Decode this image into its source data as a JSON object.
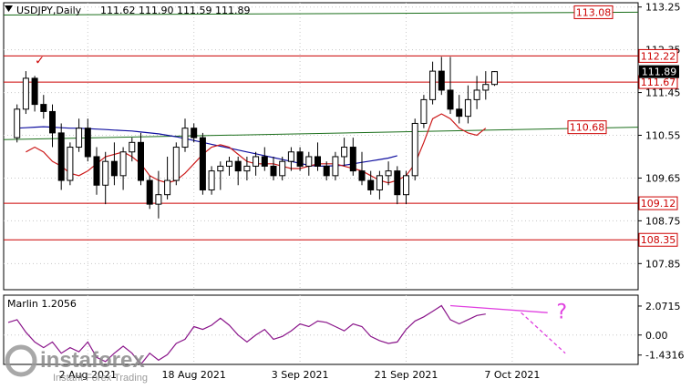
{
  "chart_data": {
    "type": "candlestick",
    "header": {
      "symbol": "USDJPY,Daily",
      "ohlc": "111.62 111.90 111.59 111.89"
    },
    "price_axis": {
      "ylim": [
        107.3,
        113.34
      ],
      "ticks": [
        "113.25",
        "112.35",
        "111.45",
        "110.55",
        "109.65",
        "108.75",
        "107.85"
      ]
    },
    "time_axis": {
      "labels": [
        {
          "text": "2 Aug 2021",
          "idx": 9
        },
        {
          "text": "18 Aug 2021",
          "idx": 21
        },
        {
          "text": "3 Sep 2021",
          "idx": 33
        },
        {
          "text": "21 Sep 2021",
          "idx": 45
        },
        {
          "text": "7 Oct 2021",
          "idx": 57
        }
      ]
    },
    "levels": [
      {
        "label": "113.08",
        "value": 113.08,
        "line_color": "#1a6e1a",
        "label_color": "#cc0000",
        "slope_to": 113.14
      },
      {
        "label": "112.22",
        "value": 112.22,
        "line_color": "#cc0000",
        "label_color": "#cc0000"
      },
      {
        "label": "111.67",
        "value": 111.67,
        "line_color": "#cc0000",
        "label_color": "#cc0000"
      },
      {
        "label": "110.68",
        "value": 110.46,
        "line_color": "#1a6e1a",
        "label_color": "#cc0000",
        "slope_to": 110.72
      },
      {
        "label": "109.12",
        "value": 109.12,
        "line_color": "#cc0000",
        "label_color": "#cc0000"
      },
      {
        "label": "108.35",
        "value": 108.35,
        "line_color": "#cc0000",
        "label_color": "#cc0000"
      }
    ],
    "current_price": "111.89",
    "candles": [
      [
        110.5,
        111.2,
        110.4,
        111.1
      ],
      [
        111.1,
        111.9,
        111.0,
        111.75
      ],
      [
        111.75,
        111.8,
        111.05,
        111.2
      ],
      [
        111.2,
        111.4,
        110.9,
        111.05
      ],
      [
        111.05,
        111.2,
        110.3,
        110.6
      ],
      [
        110.6,
        110.8,
        109.4,
        109.6
      ],
      [
        109.6,
        110.4,
        109.5,
        110.3
      ],
      [
        110.3,
        110.9,
        110.2,
        110.7
      ],
      [
        110.7,
        110.9,
        110.0,
        110.1
      ],
      [
        110.1,
        110.3,
        109.3,
        109.5
      ],
      [
        109.5,
        110.2,
        109.1,
        110.0
      ],
      [
        110.0,
        110.4,
        109.5,
        109.7
      ],
      [
        109.7,
        110.3,
        109.4,
        110.2
      ],
      [
        110.2,
        110.5,
        110.0,
        110.4
      ],
      [
        110.4,
        110.6,
        109.5,
        109.6
      ],
      [
        109.6,
        109.7,
        109.0,
        109.1
      ],
      [
        109.1,
        109.8,
        108.8,
        109.3
      ],
      [
        109.3,
        110.1,
        109.2,
        109.6
      ],
      [
        109.6,
        110.4,
        109.5,
        110.3
      ],
      [
        110.3,
        110.9,
        110.2,
        110.7
      ],
      [
        110.7,
        110.8,
        110.4,
        110.5
      ],
      [
        110.5,
        110.6,
        109.3,
        109.4
      ],
      [
        109.4,
        109.9,
        109.3,
        109.8
      ],
      [
        109.8,
        110.0,
        109.4,
        109.9
      ],
      [
        109.9,
        110.1,
        109.7,
        110.0
      ],
      [
        110.0,
        110.1,
        109.5,
        109.8
      ],
      [
        109.8,
        110.1,
        109.6,
        109.9
      ],
      [
        109.9,
        110.2,
        109.7,
        110.1
      ],
      [
        110.1,
        110.3,
        109.8,
        109.9
      ],
      [
        109.9,
        110.1,
        109.6,
        109.7
      ],
      [
        109.7,
        110.1,
        109.6,
        110.0
      ],
      [
        110.0,
        110.3,
        109.8,
        110.2
      ],
      [
        110.2,
        110.3,
        109.8,
        109.9
      ],
      [
        109.9,
        110.2,
        109.7,
        110.1
      ],
      [
        110.1,
        110.4,
        109.8,
        109.9
      ],
      [
        109.9,
        110.0,
        109.6,
        109.7
      ],
      [
        109.7,
        110.2,
        109.6,
        110.1
      ],
      [
        110.1,
        110.5,
        109.9,
        110.3
      ],
      [
        110.3,
        110.5,
        109.7,
        109.8
      ],
      [
        109.8,
        110.2,
        109.5,
        109.6
      ],
      [
        109.6,
        109.8,
        109.3,
        109.4
      ],
      [
        109.4,
        109.8,
        109.2,
        109.7
      ],
      [
        109.7,
        110.0,
        109.5,
        109.8
      ],
      [
        109.8,
        109.9,
        109.1,
        109.3
      ],
      [
        109.3,
        109.8,
        109.1,
        109.7
      ],
      [
        109.7,
        110.9,
        109.6,
        110.8
      ],
      [
        110.8,
        111.4,
        110.7,
        111.3
      ],
      [
        111.3,
        112.1,
        111.2,
        111.9
      ],
      [
        111.9,
        112.2,
        111.4,
        111.5
      ],
      [
        111.5,
        112.2,
        111.0,
        111.1
      ],
      [
        111.1,
        111.4,
        110.8,
        110.95
      ],
      [
        110.95,
        111.6,
        110.8,
        111.3
      ],
      [
        111.3,
        111.8,
        111.1,
        111.5
      ],
      [
        111.5,
        111.9,
        111.3,
        111.62
      ],
      [
        111.62,
        111.9,
        111.59,
        111.89
      ]
    ],
    "candle_offset": 1,
    "ma_blue": [
      110.7,
      110.71,
      110.72,
      110.73,
      110.72,
      110.71,
      110.7,
      110.7,
      110.69,
      110.68,
      110.67,
      110.66,
      110.65,
      110.64,
      110.62,
      110.6,
      110.58,
      110.55,
      110.52,
      110.48,
      110.44,
      110.4,
      110.36,
      110.32,
      110.28,
      110.24,
      110.2,
      110.16,
      110.12,
      110.08,
      110.04,
      110.0,
      109.96,
      109.92,
      109.9,
      109.9,
      109.91,
      109.92,
      109.95,
      109.98,
      110.01,
      110.04,
      110.07,
      110.12
    ],
    "ma_blue_offset": 1,
    "ma_red": [
      110.2,
      110.3,
      110.2,
      110.0,
      109.9,
      109.75,
      109.7,
      109.8,
      109.95,
      110.1,
      110.15,
      110.2,
      110.1,
      109.95,
      109.7,
      109.6,
      109.55,
      109.6,
      109.75,
      109.95,
      110.15,
      110.3,
      110.35,
      110.3,
      110.15,
      110.0,
      109.95,
      109.95,
      109.95,
      109.9,
      109.85,
      109.85,
      109.9,
      109.95,
      109.95,
      109.95,
      109.9,
      109.85,
      109.8,
      109.7,
      109.6,
      109.55,
      109.6,
      109.7,
      109.95,
      110.4,
      110.9,
      111.0,
      110.9,
      110.7,
      110.6,
      110.55,
      110.7
    ],
    "ma_red_offset": 2,
    "indicator": {
      "name": "Marlin 1.2056",
      "ylim": [
        -2.1,
        2.85
      ],
      "ticks": [
        "2.0715",
        "0.00",
        "-1.4316"
      ],
      "values": [
        0.9,
        1.1,
        0.2,
        -0.5,
        -0.9,
        -0.5,
        -1.3,
        -0.9,
        -1.2,
        -0.5,
        -1.6,
        -1.9,
        -1.3,
        -0.8,
        -1.3,
        -2.1,
        -1.3,
        -1.8,
        -1.4,
        -0.6,
        -0.3,
        0.6,
        0.4,
        0.7,
        1.2,
        0.7,
        0.0,
        -0.5,
        0.0,
        0.4,
        -0.3,
        -0.1,
        0.3,
        0.8,
        0.6,
        1.0,
        0.9,
        0.6,
        0.3,
        0.8,
        0.6,
        -0.1,
        -0.4,
        -0.6,
        -0.5,
        0.4,
        1.0,
        1.3,
        1.7,
        2.1,
        1.1,
        0.8,
        1.1,
        1.4,
        1.5
      ],
      "values_offset": 0,
      "divergence_line": {
        "from": [
          50,
          2.1
        ],
        "to": [
          61,
          1.6
        ],
        "color": "#e040e0"
      },
      "forecast": {
        "from": [
          58,
          1.6
        ],
        "to": [
          63,
          -1.3
        ],
        "color": "#e040e0"
      },
      "question_mark": "?"
    },
    "marker": "✓",
    "colors": {
      "bull": "#ffffff",
      "bear": "#000000",
      "ma_blue": "#1010a0",
      "ma_red": "#cc1a1a",
      "osc": "#8a158a",
      "grid": "#c8c8c8"
    },
    "watermark": {
      "brand": "instaforex",
      "tagline": "Instant Forex Trading"
    }
  }
}
